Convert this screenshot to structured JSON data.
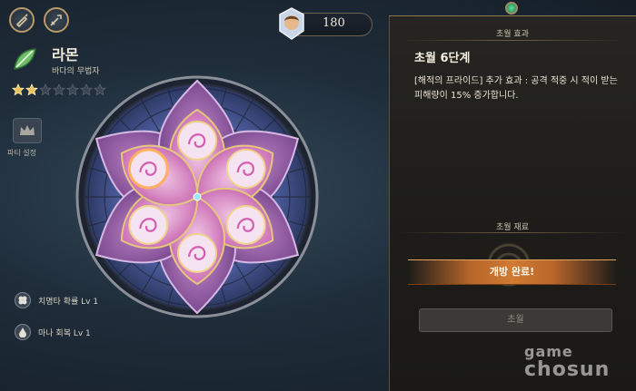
{
  "hero": {
    "name": "라몬",
    "title": "바다의 무법자",
    "stars_total": 7,
    "stars_filled": 2,
    "class_icon": "leaf-bow-icon"
  },
  "crown": {
    "label": "파티 설정"
  },
  "skills": [
    {
      "icon": "clover-icon",
      "label": "치명타 확률 Lv 1"
    },
    {
      "icon": "droplet-icon",
      "label": "마나 회복 Lv 1"
    }
  ],
  "currency": {
    "icon": "character-portrait-token",
    "value": "180"
  },
  "panel": {
    "effect_header": "초월 효과",
    "effect_title": "초월 6단계",
    "effect_desc": "[해적의 프라이드] 추가 효과 : 공격 적중 시 적이 받는 피해량이 15% 증가합니다.",
    "material_header": "초월 재료",
    "open_button": "개방 완료!",
    "transcend_button": "초월"
  },
  "watermark": {
    "line1": "game",
    "line2": "chosun"
  },
  "colors": {
    "accent_orange": "#d07a32",
    "petal_pink": "#c45aa8",
    "star_gold": "#e7c35a"
  }
}
